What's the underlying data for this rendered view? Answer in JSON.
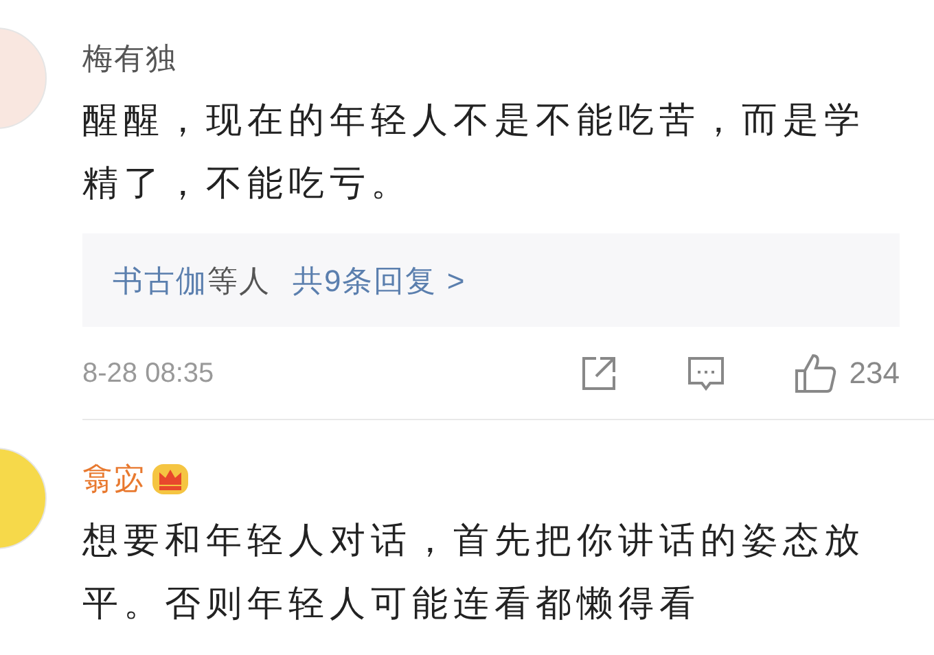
{
  "comments": [
    {
      "name": "梅有独",
      "vip": false,
      "body": "醒醒，现在的年轻人不是不能吃苦，而是学精了，不能吃亏。",
      "replies": {
        "users": "书古伽",
        "suffix": "等人",
        "count_link": "共9条回复 >"
      },
      "time": "8-28 08:35",
      "likes": "234"
    },
    {
      "name": "翕宓",
      "vip": true,
      "body": "想要和年轻人对话，首先把你讲话的姿态放平。否则年轻人可能连看都懒得看"
    }
  ]
}
